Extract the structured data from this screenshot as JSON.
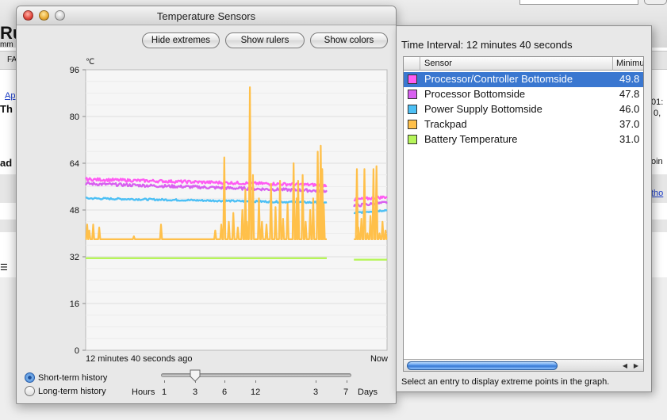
{
  "background_fragments": [
    "Ru",
    "mm",
    "FA",
    "Ap",
    "Th",
    "ad",
    "01:",
    "0,",
    "oin",
    "tho"
  ],
  "window": {
    "title": "Temperature Sensors"
  },
  "buttons": {
    "hide_extremes": "Hide extremes",
    "show_rulers": "Show rulers",
    "show_colors": "Show colors"
  },
  "chart_data": {
    "type": "line",
    "ylabel": "℃",
    "y_ticks": [
      "96",
      "80",
      "64",
      "48",
      "32",
      "16",
      "0"
    ],
    "ylim": [
      0,
      96
    ],
    "x_start_label": "12 minutes 40 seconds ago",
    "x_end_label": "Now",
    "grid": true,
    "gap_between": [
      0.8,
      0.89
    ],
    "series": [
      {
        "name": "Processor/Controller Bottomside",
        "color": "#ff5cf3",
        "start": 58.5,
        "end": 56.5,
        "resume": 51.5,
        "resume_end": 52.5,
        "noise": 0.5
      },
      {
        "name": "Processor Bottomside",
        "color": "#d860f0",
        "start": 57,
        "end": 54.5,
        "resume": 49.5,
        "resume_end": 50.5,
        "noise": 0.5
      },
      {
        "name": "Power Supply Bottomside",
        "color": "#4dc0f5",
        "start": 52,
        "end": 50.5,
        "resume": 47,
        "resume_end": 48,
        "noise": 0.3
      },
      {
        "name": "Trackpad",
        "color": "#ffc04a",
        "base": 38,
        "noise": 0
      },
      {
        "name": "Battery Temperature",
        "color": "#b6f55a",
        "start": 31.5,
        "end": 31.5,
        "resume": 31,
        "resume_end": 31,
        "noise": 0
      }
    ]
  },
  "history": {
    "short_term": "Short-term history",
    "long_term": "Long-term history",
    "selected": "short_term"
  },
  "scale": {
    "hours_label": "Hours",
    "hours": [
      "1",
      "3",
      "6",
      "12"
    ],
    "days": [
      "3",
      "7"
    ],
    "days_label": "Days",
    "slider_value": "3"
  },
  "drawer": {
    "time_interval": "Time Interval: 12 minutes 40 seconds",
    "columns": {
      "sensor": "Sensor",
      "minimum": "Minimu"
    },
    "sensors": [
      {
        "name": "Processor/Controller Bottomside",
        "min": "49.8",
        "color": "#ff5cf3",
        "selected": true
      },
      {
        "name": "Processor Bottomside",
        "min": "47.8",
        "color": "#d860f0",
        "selected": false
      },
      {
        "name": "Power Supply Bottomside",
        "min": "46.0",
        "color": "#4dc0f5",
        "selected": false
      },
      {
        "name": "Trackpad",
        "min": "37.0",
        "color": "#ffc04a",
        "selected": false
      },
      {
        "name": "Battery Temperature",
        "min": "31.0",
        "color": "#b6f55a",
        "selected": false
      }
    ],
    "hint": "Select an entry to display extreme points in the graph."
  }
}
